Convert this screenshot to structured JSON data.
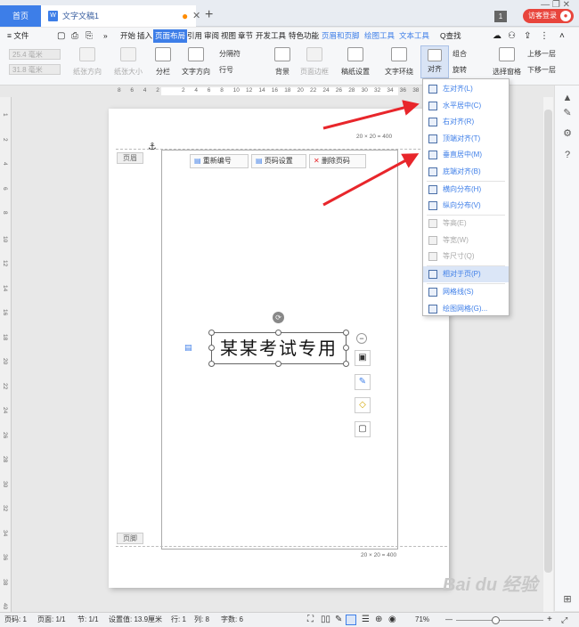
{
  "titlebar": {
    "home_tab": "首页",
    "doc_tab": "文字文稿1",
    "doc_icon": "W",
    "modified_dot": "●",
    "close": "✕",
    "new_tab": "+",
    "window_controls": "—  ❐  ✕",
    "badge": "1",
    "login": "访客登录"
  },
  "menubar": {
    "file": "≡ 文件",
    "items": [
      "开始",
      "插入",
      "页面布局",
      "引用",
      "审阅",
      "视图",
      "章节",
      "开发工具",
      "特色功能",
      "页眉和页脚",
      "绘图工具",
      "文本工具"
    ],
    "search": "Q查找"
  },
  "ribbon": {
    "margin_top": "25.4 毫米",
    "margin_bottom": "31.8 毫米",
    "orientation": "纸张方向",
    "paper_size": "纸张大小",
    "columns": "分栏",
    "text_direction": "文字方向",
    "separator": "分隔符",
    "line_number": "行号",
    "background": "背景",
    "page_border": "页面边框",
    "manuscript": "稿纸设置",
    "text_wrap": "文字环绕",
    "align": "对齐",
    "group": "组合",
    "rotate": "旋转",
    "selection_pane": "选择窗格",
    "bring_forward": "上移一层",
    "send_backward": "下移一层"
  },
  "ruler_h": [
    "8",
    "6",
    "4",
    "2",
    "",
    "2",
    "4",
    "6",
    "8",
    "10",
    "12",
    "14",
    "16",
    "18",
    "20",
    "22",
    "24",
    "26",
    "28",
    "30",
    "32",
    "34",
    "36",
    "38",
    "40"
  ],
  "ruler_v": [
    "1",
    "2",
    "4",
    "6",
    "8",
    "10",
    "12",
    "14",
    "16",
    "18",
    "20",
    "22",
    "24",
    "26",
    "28",
    "30",
    "32",
    "34",
    "36",
    "38",
    "40"
  ],
  "page": {
    "header_label": "页眉",
    "footer_label": "页脚",
    "renumber": "重新编号",
    "page_setup": "页码设置",
    "delete_page_num": "删除页码",
    "textbox_text": "某某考试专用",
    "grid_label_top": "20 × 20 = 400",
    "grid_label_bottom": "20 × 20 = 400"
  },
  "dropdown": {
    "items": [
      {
        "label": "左对齐(L)",
        "enabled": true
      },
      {
        "label": "水平居中(C)",
        "enabled": true
      },
      {
        "label": "右对齐(R)",
        "enabled": true
      },
      {
        "label": "顶端对齐(T)",
        "enabled": true
      },
      {
        "label": "垂直居中(M)",
        "enabled": true
      },
      {
        "label": "底端对齐(B)",
        "enabled": true
      },
      {
        "label": "横向分布(H)",
        "enabled": true
      },
      {
        "label": "纵向分布(V)",
        "enabled": true
      },
      {
        "label": "等高(E)",
        "enabled": false
      },
      {
        "label": "等宽(W)",
        "enabled": false
      },
      {
        "label": "等尺寸(Q)",
        "enabled": false
      },
      {
        "label": "相对于页(P)",
        "enabled": true,
        "selected": true
      },
      {
        "label": "网格线(S)",
        "enabled": true
      },
      {
        "label": "绘图网格(G)...",
        "enabled": true
      }
    ]
  },
  "statusbar": {
    "page_num": "页码: 1",
    "pages": "页面: 1/1",
    "section": "节: 1/1",
    "setting": "设置值: 13.9厘米",
    "row": "行: 1",
    "col": "列: 8",
    "words": "字数: 6",
    "zoom": "71%",
    "zoom_minus": "—",
    "zoom_plus": "+",
    "zoom_value": 0.45
  },
  "colors": {
    "accent": "#3d7ee8",
    "login": "#e8453c",
    "arrow": "#e8262b"
  }
}
